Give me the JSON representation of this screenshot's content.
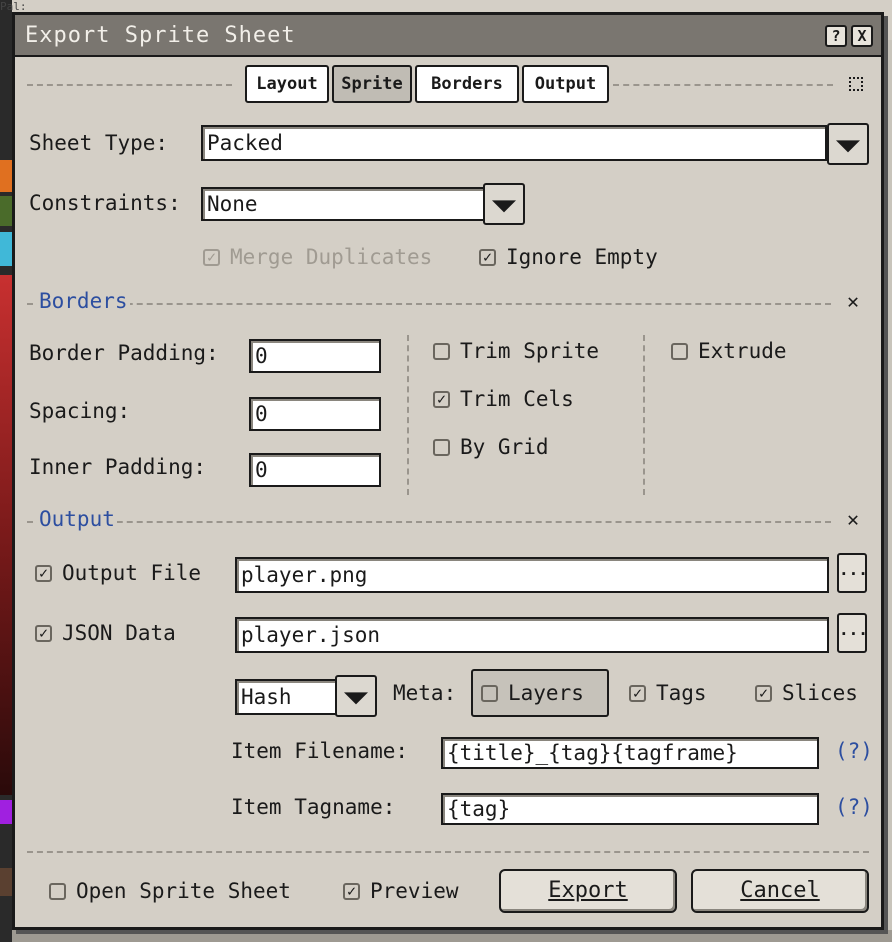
{
  "dialog": {
    "title": "Export Sprite Sheet",
    "help_btn": "?",
    "close_btn": "X"
  },
  "tabs": [
    {
      "label": "Layout",
      "active": false
    },
    {
      "label": "Sprite",
      "active": true
    },
    {
      "label": "Borders",
      "active": false
    },
    {
      "label": "Output",
      "active": false
    }
  ],
  "layout": {
    "sheet_type_label": "Sheet Type:",
    "sheet_type_value": "Packed",
    "constraints_label": "Constraints:",
    "constraints_value": "None",
    "merge_duplicates": {
      "label": "Merge Duplicates",
      "checked": true,
      "enabled": false
    },
    "ignore_empty": {
      "label": "Ignore Empty",
      "checked": true,
      "enabled": true
    }
  },
  "borders": {
    "title": "Borders",
    "border_padding_label": "Border Padding:",
    "border_padding_value": "0",
    "spacing_label": "Spacing:",
    "spacing_value": "0",
    "inner_padding_label": "Inner Padding:",
    "inner_padding_value": "0",
    "trim_sprite": {
      "label": "Trim Sprite",
      "checked": false
    },
    "trim_cels": {
      "label": "Trim Cels",
      "checked": true
    },
    "by_grid": {
      "label": "By Grid",
      "checked": false
    },
    "extrude": {
      "label": "Extrude",
      "checked": false
    }
  },
  "output": {
    "title": "Output",
    "output_file": {
      "label": "Output File",
      "checked": true,
      "value": "player.png"
    },
    "json_data": {
      "label": "JSON Data",
      "checked": true,
      "value": "player.json"
    },
    "browse_label": "...",
    "format_value": "Hash",
    "meta_label": "Meta:",
    "layers": {
      "label": "Layers",
      "checked": false
    },
    "tags": {
      "label": "Tags",
      "checked": true
    },
    "slices": {
      "label": "Slices",
      "checked": true
    },
    "item_filename_label": "Item Filename:",
    "item_filename_value": "{title}_{tag}{tagframe}",
    "item_tagname_label": "Item Tagname:",
    "item_tagname_value": "{tag}",
    "help_link": "(?)"
  },
  "footer": {
    "open_sprite_sheet": {
      "label": "Open Sprite Sheet",
      "checked": false
    },
    "preview": {
      "label": "Preview",
      "checked": true
    },
    "export_label": "Export",
    "cancel_label": "Cancel"
  },
  "background": {
    "top_left_text": "Pal:",
    "palette_colors": [
      "#e07020",
      "#4a6b2a",
      "#40b8d8",
      "#c83030",
      "#5a4030",
      "#a020e0"
    ]
  }
}
